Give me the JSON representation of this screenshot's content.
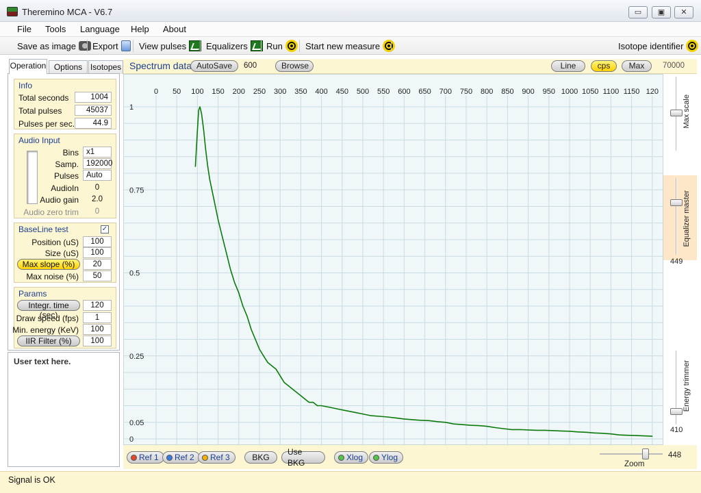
{
  "window": {
    "title": "Theremino MCA - V6.7",
    "minimize": "▭",
    "restore": "▣",
    "close": "✕"
  },
  "menu": [
    "File",
    "Tools",
    "Language",
    "Help",
    "About"
  ],
  "toolbar": {
    "save_image": "Save as image",
    "export": "Export",
    "view_pulses": "View pulses",
    "equalizers": "Equalizers",
    "run": "Run",
    "start_new": "Start new measure",
    "isotope_identifier": "Isotope identifier"
  },
  "tabs": [
    "Operation",
    "Options",
    "Isotopes"
  ],
  "info": {
    "title": "Info",
    "total_seconds_label": "Total seconds",
    "total_seconds": "1004",
    "total_pulses_label": "Total pulses",
    "total_pulses": "45037",
    "pps_label": "Pulses per sec.",
    "pps": "44.9"
  },
  "audio": {
    "title": "Audio Input",
    "bins_label": "Bins",
    "bins": "x1",
    "samp_label": "Samp.",
    "samp": "192000",
    "pulses_label": "Pulses",
    "pulses": "Auto",
    "audioin_label": "AudioIn",
    "audioin": "0",
    "gain_label": "Audio gain",
    "gain": "2.0",
    "zero_trim_label": "Audio zero trim",
    "zero_trim": "0"
  },
  "baseline": {
    "title": "BaseLine test",
    "checked": "✓",
    "position_label": "Position (uS)",
    "position": "100",
    "size_label": "Size (uS)",
    "size": "100",
    "max_slope_label": "Max slope (%)",
    "max_slope": "20",
    "max_noise_label": "Max noise (%)",
    "max_noise": "50"
  },
  "params": {
    "title": "Params",
    "integr_label": "Integr. time (sec)",
    "integr": "120",
    "draw_label": "Draw speed (fps)",
    "draw": "1",
    "min_energy_label": "Min. energy (KeV)",
    "min_energy": "100",
    "iir_label": "IIR Filter (%)",
    "iir": "100"
  },
  "user_text": "User text here.",
  "spectrum": {
    "title": "Spectrum data",
    "autosave": "AutoSave",
    "autosave_value": "600",
    "browse": "Browse",
    "line": "Line",
    "cps": "cps",
    "max": "Max",
    "max_value": "70000"
  },
  "right_sliders": {
    "max_scale": "Max scale",
    "equalizer_master": "Equalizer master",
    "equalizer_value": "449",
    "energy_trimmer": "Energy trimmer",
    "energy_value": "410"
  },
  "bottom": {
    "ref1": "Ref 1",
    "ref2": "Ref 2",
    "ref3": "Ref 3",
    "bkg": "BKG",
    "use_bkg": "Use BKG",
    "xlog": "Xlog",
    "ylog": "Ylog",
    "zoom_label": "Zoom",
    "zoom_value": "448"
  },
  "status": "Signal is OK",
  "colors": {
    "panel_bg": "#fdf6d2",
    "plot_bg": "#f0f7f9",
    "grid": "#c9dbe2",
    "curve": "#0a7a0a",
    "accent_title": "#1a3f8f"
  },
  "chart_data": {
    "type": "line",
    "x_ticks": [
      "0",
      "50",
      "100",
      "150",
      "200",
      "250",
      "300",
      "350",
      "400",
      "450",
      "500",
      "550",
      "600",
      "650",
      "700",
      "750",
      "800",
      "850",
      "900",
      "950",
      "1000",
      "1050",
      "1100",
      "1150",
      "120"
    ],
    "y_ticks": [
      "1",
      "0.75",
      "0.5",
      "0.25",
      "0.05",
      "0"
    ],
    "xlim": [
      0,
      1200
    ],
    "ylim": [
      0,
      1
    ],
    "grid": true,
    "series": [
      {
        "x": [
          95,
          100,
          103,
          106,
          110,
          115,
          120,
          125,
          130,
          140,
          150,
          160,
          170,
          180,
          190,
          200,
          210,
          220,
          230,
          240,
          250,
          260,
          270,
          280,
          290,
          300,
          310,
          320,
          330,
          340,
          350,
          360,
          370,
          380,
          390,
          400,
          420,
          440,
          460,
          480,
          500,
          520,
          540,
          560,
          580,
          600,
          620,
          640,
          660,
          680,
          700,
          720,
          740,
          760,
          780,
          800,
          820,
          840,
          860,
          880,
          900,
          920,
          940,
          960,
          980,
          1000,
          1020,
          1040,
          1060,
          1080,
          1100,
          1120,
          1140,
          1160,
          1180,
          1200
        ],
        "y": [
          0.82,
          0.93,
          0.99,
          1.0,
          0.98,
          0.93,
          0.87,
          0.82,
          0.78,
          0.72,
          0.66,
          0.61,
          0.56,
          0.51,
          0.47,
          0.44,
          0.4,
          0.37,
          0.33,
          0.3,
          0.27,
          0.25,
          0.23,
          0.22,
          0.21,
          0.19,
          0.17,
          0.16,
          0.15,
          0.14,
          0.13,
          0.12,
          0.11,
          0.11,
          0.1,
          0.1,
          0.095,
          0.09,
          0.085,
          0.08,
          0.075,
          0.07,
          0.068,
          0.066,
          0.063,
          0.06,
          0.058,
          0.056,
          0.055,
          0.052,
          0.05,
          0.045,
          0.043,
          0.041,
          0.04,
          0.038,
          0.034,
          0.031,
          0.028,
          0.028,
          0.027,
          0.026,
          0.026,
          0.025,
          0.024,
          0.023,
          0.021,
          0.02,
          0.018,
          0.017,
          0.015,
          0.012,
          0.011,
          0.01,
          0.009,
          0.008
        ]
      }
    ]
  }
}
